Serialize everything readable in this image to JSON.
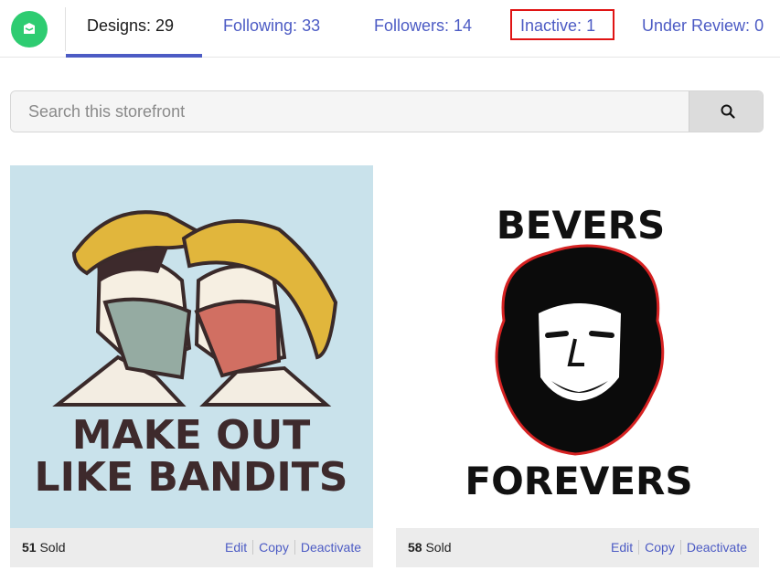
{
  "tabs": [
    {
      "label": "Designs:",
      "count": "29"
    },
    {
      "label": "Following:",
      "count": "33"
    },
    {
      "label": "Followers:",
      "count": "14"
    },
    {
      "label": "Inactive:",
      "count": "1"
    },
    {
      "label": "Under Review:",
      "count": "0"
    }
  ],
  "search": {
    "placeholder": "Search this storefront",
    "value": "",
    "icon": "search-icon"
  },
  "designs": [
    {
      "poster_line1": "MAKE OUT",
      "poster_line2": "LIKE BANDITS",
      "sold_count": "51",
      "sold_label": "Sold",
      "actions": {
        "edit": "Edit",
        "copy": "Copy",
        "deactivate": "Deactivate"
      }
    },
    {
      "poster_top": "BEVERS",
      "poster_bottom": "FOREVERS",
      "sold_count": "58",
      "sold_label": "Sold",
      "actions": {
        "edit": "Edit",
        "copy": "Copy",
        "deactivate": "Deactivate"
      }
    }
  ],
  "colors": {
    "accent": "#4c5bc4",
    "brand": "#2ecc71",
    "highlight": "#e01414",
    "card_bg_1": "#c9e2eb"
  }
}
